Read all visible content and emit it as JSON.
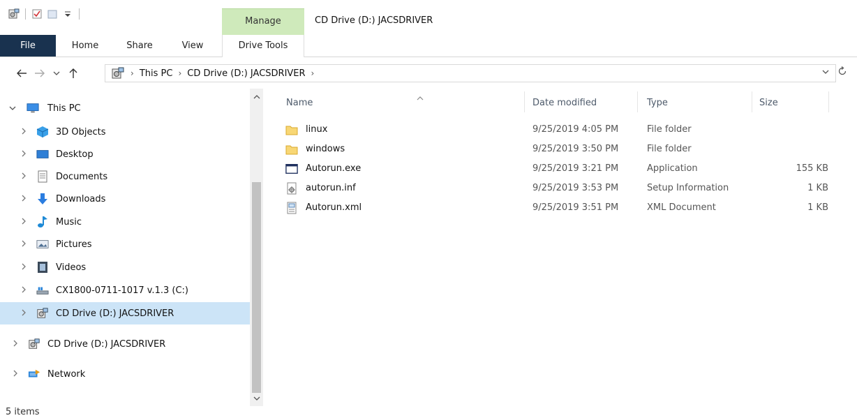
{
  "window": {
    "title": "CD Drive (D:) JACSDRIVER",
    "contextual_tab_group": "Manage"
  },
  "quick_access": {
    "icons": [
      "drive-icon",
      "properties-icon",
      "new-folder-icon",
      "customize-dropdown-icon"
    ]
  },
  "ribbon": {
    "tabs": [
      {
        "id": "file",
        "label": "File"
      },
      {
        "id": "home",
        "label": "Home"
      },
      {
        "id": "share",
        "label": "Share"
      },
      {
        "id": "view",
        "label": "View"
      },
      {
        "id": "drive_tools",
        "label": "Drive Tools"
      }
    ]
  },
  "address": {
    "breadcrumbs": [
      "This PC",
      "CD Drive (D:) JACSDRIVER"
    ],
    "separator": "›"
  },
  "nav": {
    "items": [
      {
        "label": "This PC",
        "icon": "pc-icon",
        "expanded": true
      },
      {
        "label": "3D Objects",
        "icon": "3d-objects-icon"
      },
      {
        "label": "Desktop",
        "icon": "desktop-icon"
      },
      {
        "label": "Documents",
        "icon": "documents-icon"
      },
      {
        "label": "Downloads",
        "icon": "downloads-icon"
      },
      {
        "label": "Music",
        "icon": "music-icon"
      },
      {
        "label": "Pictures",
        "icon": "pictures-icon"
      },
      {
        "label": "Videos",
        "icon": "videos-icon"
      },
      {
        "label": "CX1800-0711-1017 v.1.3 (C:)",
        "icon": "hard-drive-icon"
      },
      {
        "label": "CD Drive (D:) JACSDRIVER",
        "icon": "cd-drive-icon",
        "selected": true
      },
      {
        "label": "CD Drive (D:) JACSDRIVER",
        "icon": "cd-drive-icon"
      },
      {
        "label": "Network",
        "icon": "network-icon"
      }
    ]
  },
  "filelist": {
    "columns": [
      {
        "id": "name",
        "label": "Name"
      },
      {
        "id": "date",
        "label": "Date modified"
      },
      {
        "id": "type",
        "label": "Type"
      },
      {
        "id": "size",
        "label": "Size"
      }
    ],
    "rows": [
      {
        "name": "linux",
        "date": "9/25/2019 4:05 PM",
        "type": "File folder",
        "size": "",
        "icon": "folder-icon"
      },
      {
        "name": "windows",
        "date": "9/25/2019 3:50 PM",
        "type": "File folder",
        "size": "",
        "icon": "folder-icon"
      },
      {
        "name": "Autorun.exe",
        "date": "9/25/2019 3:21 PM",
        "type": "Application",
        "size": "155 KB",
        "icon": "application-icon"
      },
      {
        "name": "autorun.inf",
        "date": "9/25/2019 3:53 PM",
        "type": "Setup Information",
        "size": "1 KB",
        "icon": "setup-info-icon"
      },
      {
        "name": "Autorun.xml",
        "date": "9/25/2019 3:51 PM",
        "type": "XML Document",
        "size": "1 KB",
        "icon": "xml-document-icon"
      }
    ]
  },
  "status": {
    "item_count": "5 items"
  },
  "colors": {
    "manage_tab": "#cfeabb",
    "file_tab": "#19324f",
    "selection": "#cce4f7"
  }
}
